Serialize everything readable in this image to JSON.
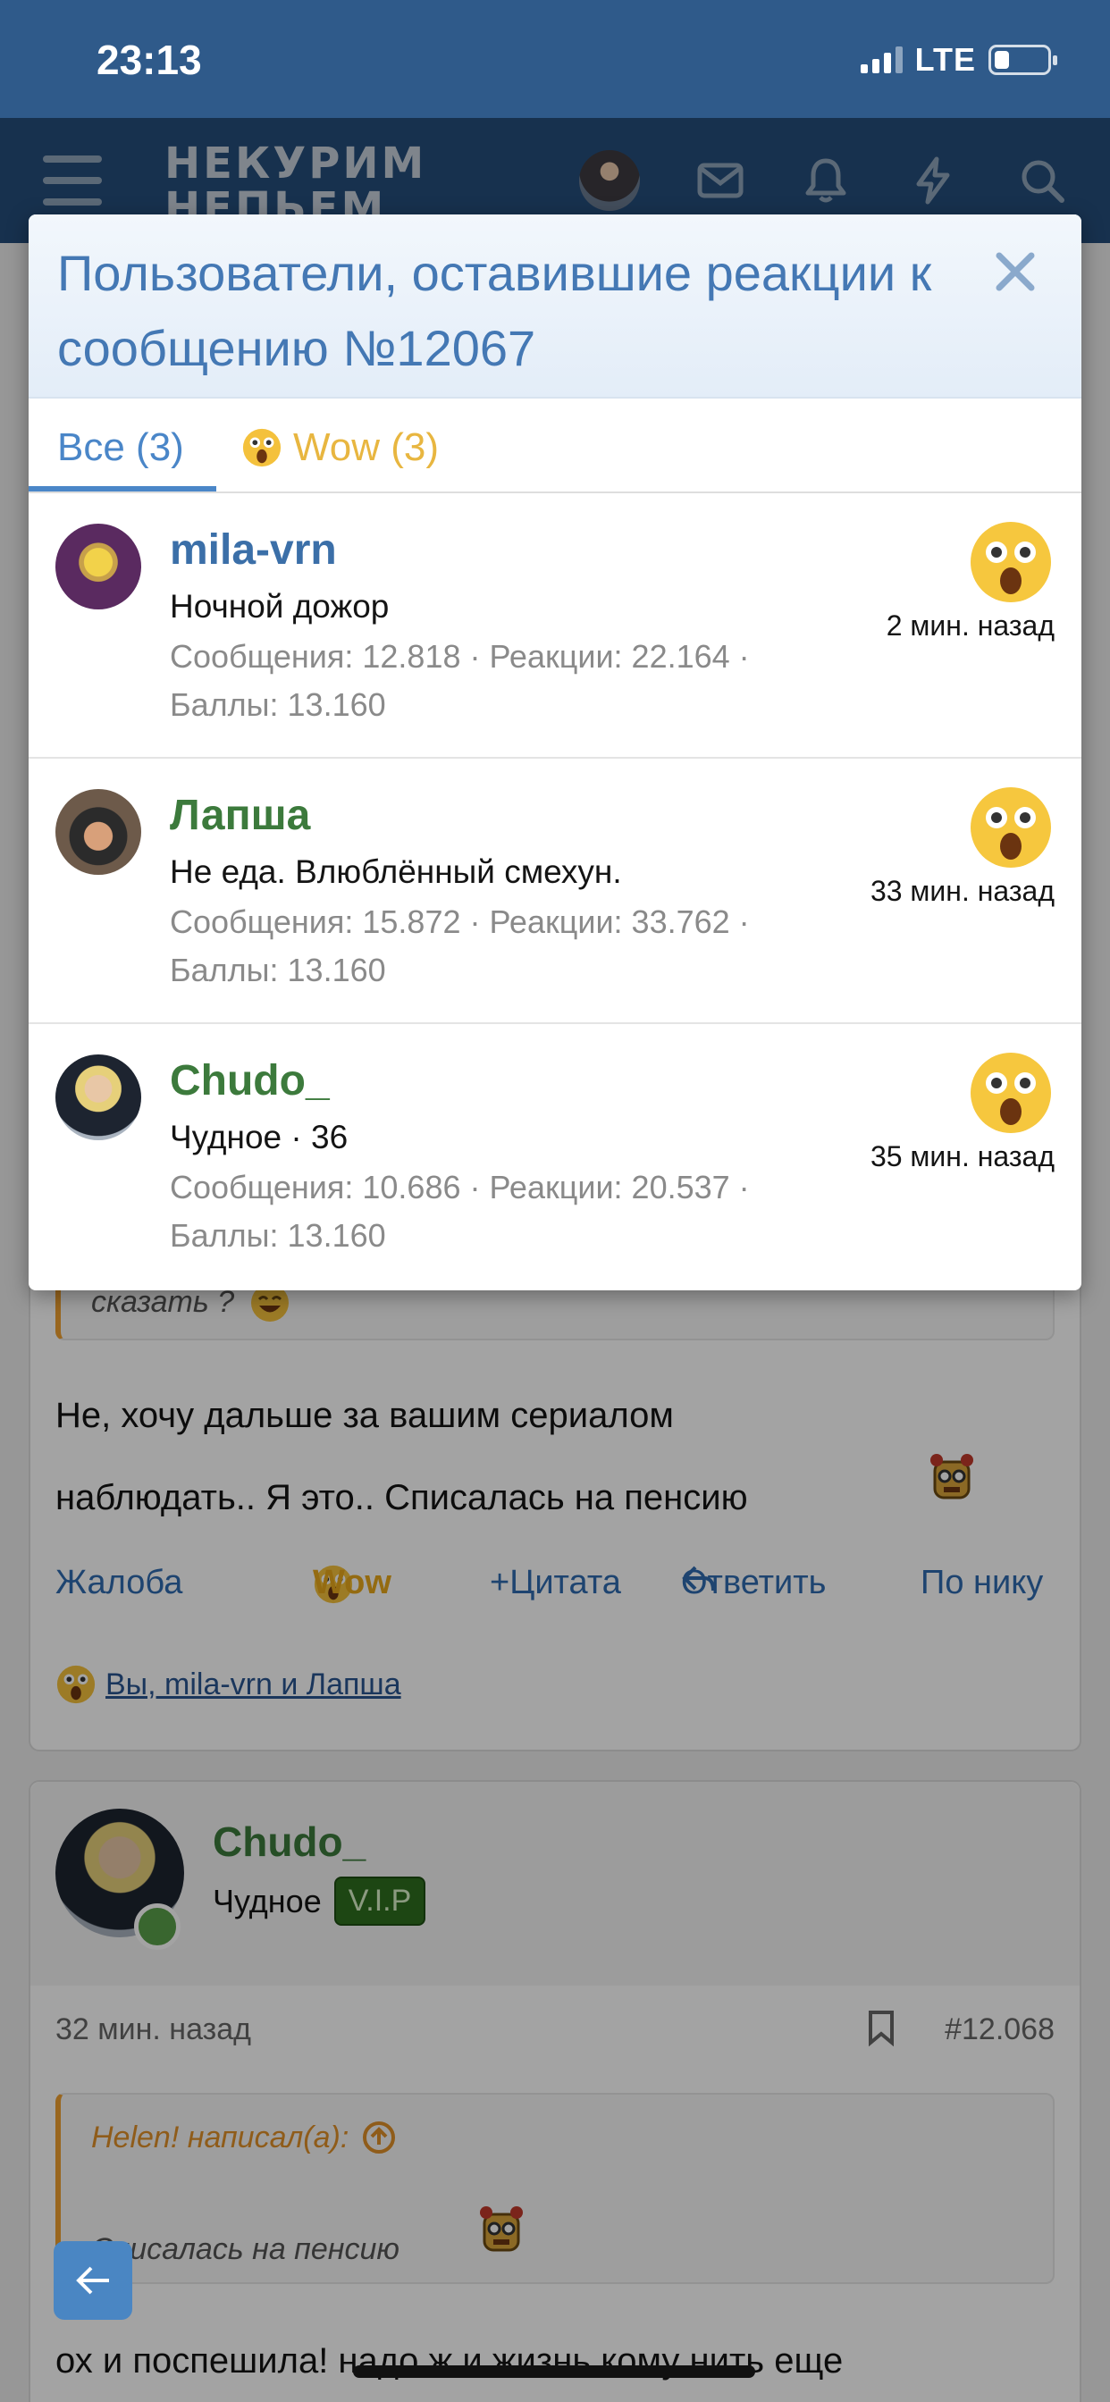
{
  "status_bar": {
    "time": "23:13",
    "network": "LTE"
  },
  "header": {
    "logo_line1": "НЕКУРИМ",
    "logo_line2": "НЕПЬЕМ"
  },
  "modal": {
    "title": "Пользователи, оставившие реакции к сообщению №12067",
    "tabs": [
      {
        "label": "Все (3)",
        "active": true
      },
      {
        "label": "Wow (3)",
        "active": false,
        "icon": "wow-emoji-icon"
      }
    ],
    "reactions": [
      {
        "name": "mila-vrn",
        "name_color": "#3b6fa8",
        "title": "Ночной дожор",
        "stats_line1": "Сообщения: 12.818 · Реакции: 22.164 ·",
        "stats_line2": "Баллы: 13.160",
        "time": "2 мин. назад",
        "reaction": "wow-emoji-icon"
      },
      {
        "name": "Лапша",
        "name_color": "#3c7a3c",
        "title": "Не еда. Влюблённый смехун.",
        "stats_line1": "Сообщения: 15.872 · Реакции: 33.762 ·",
        "stats_line2": "Баллы: 13.160",
        "time": "33 мин. назад",
        "reaction": "wow-emoji-icon"
      },
      {
        "name": "Chudo_",
        "name_color": "#3c7a3c",
        "title": "Чудное · 36",
        "stats_line1": "Сообщения: 10.686 · Реакции: 20.537 ·",
        "stats_line2": "Баллы: 13.160",
        "time": "35 мин. назад",
        "reaction": "wow-emoji-icon"
      }
    ]
  },
  "post1": {
    "quote_tail": "сказать ?",
    "text_line1": "Не, хочу дальше за вашим сериалом",
    "text_line2": "наблюдать.. Я это.. Списалась на пенсию",
    "actions": {
      "report": "Жалоба",
      "wow": "Wow",
      "quote": "Цитата",
      "reply": "Ответить",
      "by_nick": "По нику"
    },
    "reactions_summary": "Вы, mila-vrn и Лапша"
  },
  "post2": {
    "author": "Chudo_",
    "user_title": "Чудное",
    "badge": "V.I.P",
    "time": "32 мин. назад",
    "number": "#12.068",
    "quote_author": "Helen! написал(а):",
    "quote_text": "Списалась на пенсию",
    "text": "ох и поспешила! надо ж и жизнь кому нить еще"
  },
  "colors": {
    "brand": "#2f5a8a",
    "link": "#3b6fa8",
    "wow": "#e8b640",
    "vip_green": "#3c7a3c"
  }
}
